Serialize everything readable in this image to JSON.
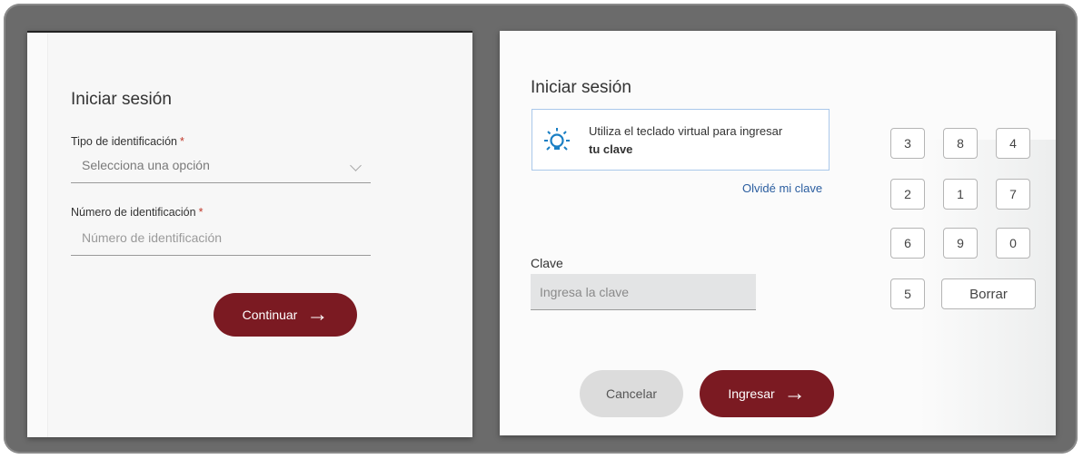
{
  "login": {
    "title": "Iniciar sesión",
    "id_type_label": "Tipo de identificación",
    "required_mark": "*",
    "id_type_value": "Selecciona una opción",
    "id_number_label": "Número de identificación",
    "id_number_placeholder": "Número de identificación",
    "continue_label": "Continuar",
    "arrow": "→"
  },
  "password": {
    "title": "Iniciar sesión",
    "info_line1": "Utiliza el teclado virtual para ingresar",
    "info_line2": "tu clave",
    "forgot_link": "Olvidé mi clave",
    "clave_label": "Clave",
    "clave_placeholder": "Ingresa la clave",
    "cancel_label": "Cancelar",
    "submit_label": "Ingresar",
    "arrow": "→"
  },
  "keypad": {
    "keys": [
      "3",
      "8",
      "4",
      "2",
      "1",
      "7",
      "6",
      "9",
      "0",
      "5"
    ],
    "delete_label": "Borrar"
  },
  "colors": {
    "primary": "#7b1a22",
    "link": "#2a5d9f",
    "info_border": "#aac8ea",
    "frame": "#6b6b6b"
  },
  "icons": {
    "info": "lightbulb-icon",
    "next": "arrow-right-icon",
    "select": "chevron-down-icon"
  }
}
